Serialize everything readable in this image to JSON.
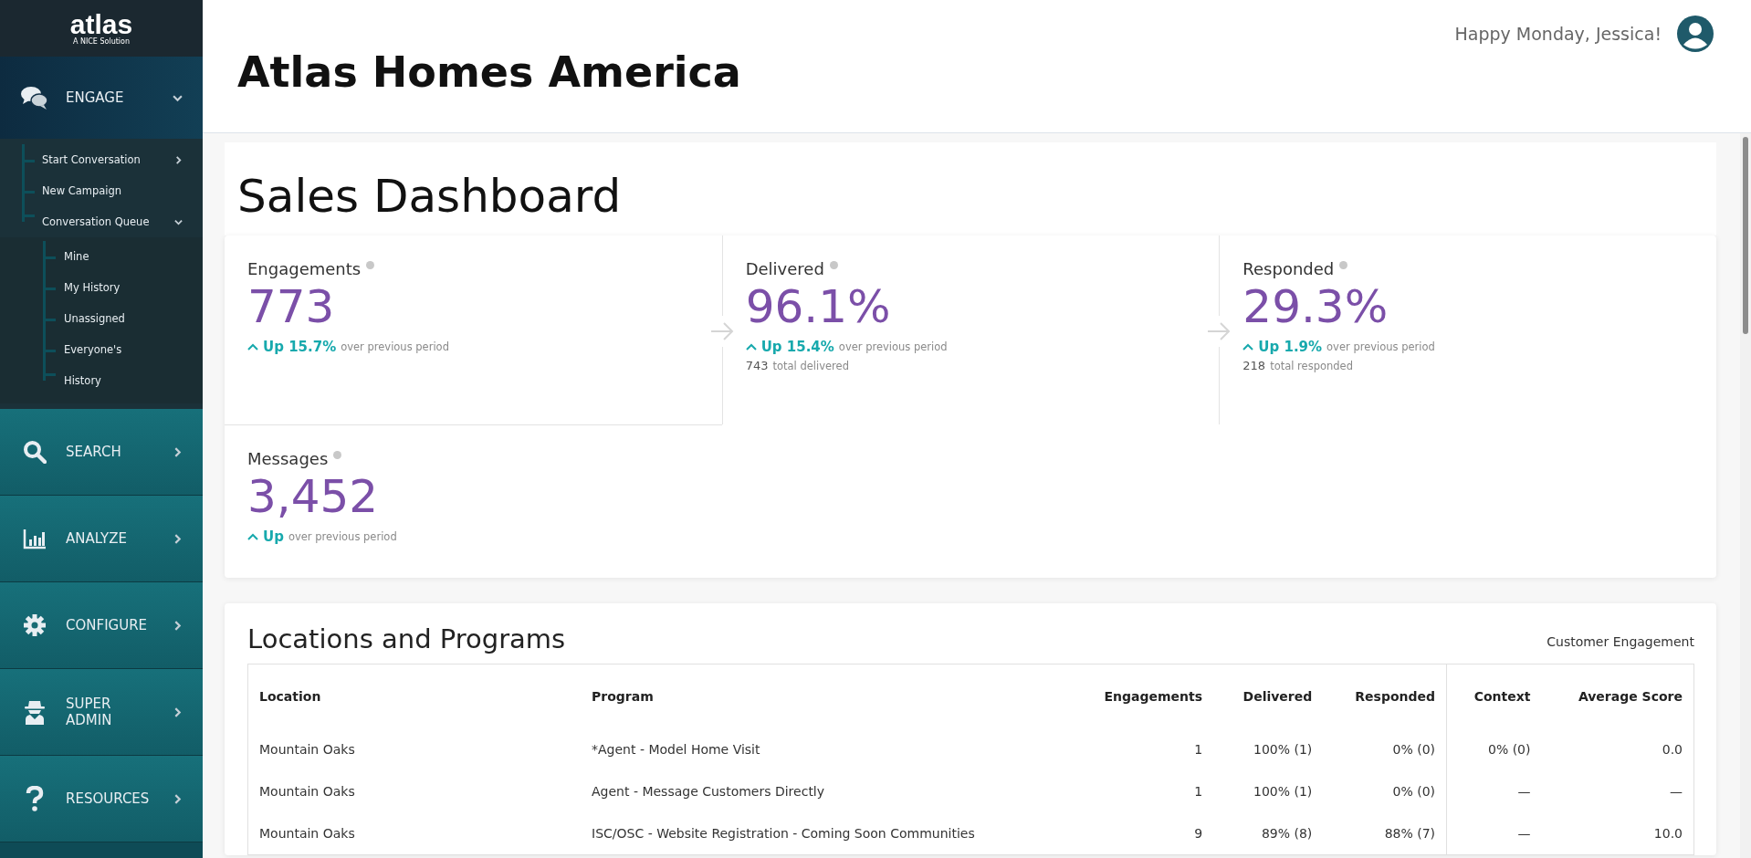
{
  "logo": {
    "name": "atlas",
    "tagline": "A NICE Solution"
  },
  "sidebar": {
    "sections": [
      {
        "label": "ENGAGE",
        "expanded": true,
        "items": [
          {
            "label": "Start Conversation",
            "expanded": false
          },
          {
            "label": "New Campaign"
          },
          {
            "label": "Conversation Queue",
            "expanded": true,
            "children": [
              {
                "label": "Mine"
              },
              {
                "label": "My History"
              },
              {
                "label": "Unassigned"
              },
              {
                "label": "Everyone's"
              },
              {
                "label": "History"
              }
            ]
          }
        ]
      },
      {
        "label": "SEARCH",
        "expanded": false
      },
      {
        "label": "ANALYZE",
        "expanded": false
      },
      {
        "label": "CONFIGURE",
        "expanded": false
      },
      {
        "label": "SUPER ADMIN",
        "expanded": false
      },
      {
        "label": "RESOURCES",
        "expanded": false
      }
    ]
  },
  "header": {
    "company": "Atlas Homes America",
    "greeting": "Happy Monday, Jessica!"
  },
  "page_title": "Sales Dashboard",
  "metrics": [
    {
      "label": "Engagements",
      "value": "773",
      "change": "Up 15.7%",
      "change_note": "over previous period"
    },
    {
      "label": "Delivered",
      "value": "96.1%",
      "change": "Up 15.4%",
      "change_note": "over previous period",
      "total": "743",
      "total_note": "total delivered"
    },
    {
      "label": "Responded",
      "value": "29.3%",
      "change": "Up 1.9%",
      "change_note": "over previous period",
      "total": "218",
      "total_note": "total responded"
    },
    {
      "label": "Messages",
      "value": "3,452",
      "change": "Up",
      "change_note": "over previous period"
    }
  ],
  "locations": {
    "title": "Locations and Programs",
    "group_label": "Customer Engagement",
    "columns": [
      "Location",
      "Program",
      "Engagements",
      "Delivered",
      "Responded",
      "Context",
      "Average Score"
    ],
    "rows": [
      [
        "Mountain Oaks",
        "*Agent - Model Home Visit",
        "1",
        "100% (1)",
        "0% (0)",
        "0% (0)",
        "0.0"
      ],
      [
        "Mountain Oaks",
        "Agent - Message Customers Directly",
        "1",
        "100% (1)",
        "0% (0)",
        "—",
        "—"
      ],
      [
        "Mountain Oaks",
        "ISC/OSC - Website Registration - Coming Soon Communities",
        "9",
        "89% (8)",
        "88% (7)",
        "—",
        "10.0"
      ]
    ]
  }
}
